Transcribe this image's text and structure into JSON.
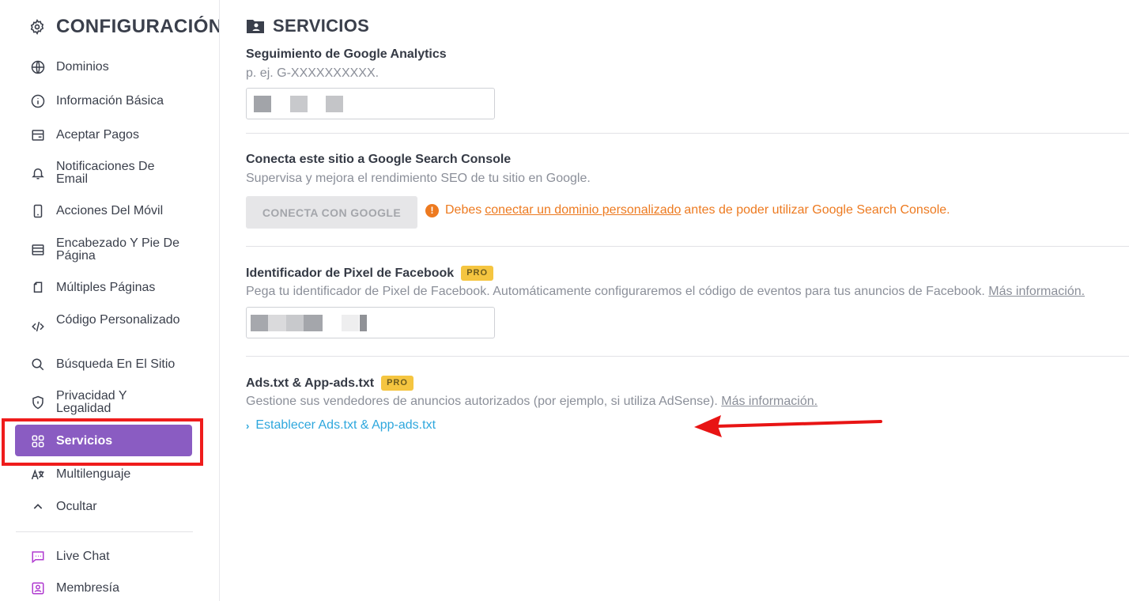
{
  "sidebar": {
    "title": "CONFIGURACIÓN",
    "items": [
      {
        "label": "Dominios",
        "icon": "globe-icon"
      },
      {
        "label": "Información Básica",
        "icon": "info-icon"
      },
      {
        "label": "Aceptar Pagos",
        "icon": "payment-card-icon"
      },
      {
        "label": "Notificaciones De Email",
        "icon": "bell-icon"
      },
      {
        "label": "Acciones Del Móvil",
        "icon": "mobile-icon"
      },
      {
        "label": "Encabezado Y Pie De Página",
        "icon": "header-footer-icon"
      },
      {
        "label": "Múltiples Páginas",
        "icon": "pages-icon"
      },
      {
        "label": "Código Personalizado",
        "icon": "code-icon"
      },
      {
        "label": "Búsqueda En El Sitio",
        "icon": "search-icon"
      },
      {
        "label": "Privacidad Y Legalidad",
        "icon": "shield-icon"
      },
      {
        "label": "Servicios",
        "icon": "grid-icon",
        "active": true
      },
      {
        "label": "Multilenguaje",
        "icon": "translate-icon"
      },
      {
        "label": "Ocultar",
        "icon": "chevron-up-icon"
      }
    ],
    "extras": [
      {
        "label": "Live Chat",
        "icon": "chat-icon"
      },
      {
        "label": "Membresía",
        "icon": "member-icon"
      }
    ],
    "accent": "#8a5cc2"
  },
  "main": {
    "title": "SERVICIOS",
    "analytics": {
      "title": "Seguimiento de Google Analytics",
      "hint": "p. ej. G-XXXXXXXXXX."
    },
    "search_console": {
      "title": "Conecta este sitio a Google Search Console",
      "desc": "Supervisa y mejora el rendimiento SEO de tu sitio en Google.",
      "button": "CONECTA CON GOOGLE",
      "warn_before": "Debes",
      "warn_link": "conectar un dominio personalizado",
      "warn_after": "antes de poder utilizar Google Search Console.",
      "warn_color": "#ed7a20"
    },
    "facebook": {
      "title": "Identificador de Pixel de Facebook",
      "badge": "PRO",
      "desc": "Pega tu identificador de Pixel de Facebook. Automáticamente configuraremos el código de eventos para tus anuncios de Facebook.",
      "more": "Más información."
    },
    "ads": {
      "title": "Ads.txt & App-ads.txt",
      "badge": "PRO",
      "desc": "Gestione sus vendedores de anuncios autorizados (por ejemplo, si utiliza AdSense).",
      "more": "Más información.",
      "link": "Establecer Ads.txt & App-ads.txt",
      "link_color": "#2ea7dd"
    }
  }
}
